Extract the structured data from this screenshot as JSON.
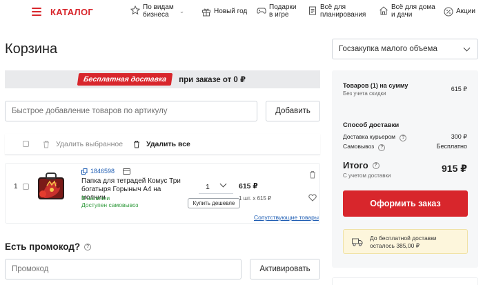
{
  "nav": {
    "catalog": "КАТАЛОГ",
    "items": [
      {
        "line1": "По видам",
        "line2": "бизнеса",
        "icon": "star-icon"
      },
      {
        "line1": "Новый год",
        "line2": "",
        "icon": "gift-icon"
      },
      {
        "line1": "Подарки",
        "line2": "в игре",
        "icon": "gamepad-icon"
      },
      {
        "line1": "Всё для",
        "line2": "планирования",
        "icon": "clipboard-icon"
      },
      {
        "line1": "Всё для дома",
        "line2": "и дачи",
        "icon": "house-icon"
      },
      {
        "line1": "Акции",
        "line2": "",
        "icon": "percent-icon"
      }
    ]
  },
  "page": {
    "title": "Корзина"
  },
  "org_select": {
    "value": "Госзакупка малого объема"
  },
  "banner": {
    "badge": "Бесплатная доставка",
    "text": "при заказе от 0 ₽"
  },
  "quick_add": {
    "placeholder": "Быстрое добавление товаров по артикулу",
    "button": "Добавить"
  },
  "bulk": {
    "delete_selected": "Удалить выбранное",
    "delete_all": "Удалить все"
  },
  "item": {
    "index": "1",
    "sku": "1846598",
    "name": "Папка для тетрадей Комус Три богатыря Горыныч А4 на молнии",
    "stock": "В наличии",
    "pickup": "Доступен самовывоз",
    "qty": "1",
    "price": "615 ₽",
    "unit_price": "1 шт. x 615 ₽",
    "cheaper_btn": "Купить дешевле",
    "related": "Сопутствующие товары"
  },
  "promo": {
    "title": "Есть промокод?",
    "placeholder": "Промокод",
    "button": "Активировать"
  },
  "summary": {
    "goods_label": "Товаров (1) на сумму",
    "goods_value": "615 ₽",
    "no_discount": "Без учета скидки",
    "delivery_head": "Способ доставки",
    "courier_label": "Доставка курьером",
    "courier_value": "300 ₽",
    "pickup_label": "Самовывоз",
    "pickup_value": "Бесплатно",
    "total_label": "Итого",
    "total_value": "915 ₽",
    "total_sub": "С учетом доставки",
    "order_button": "Оформить заказ",
    "free_line1": "До бесплатной доставки",
    "free_line2": "осталось 385,00 ₽"
  },
  "colors": {
    "accent": "#d8262c",
    "link": "#1e5db3",
    "green": "#2f9a3b"
  }
}
